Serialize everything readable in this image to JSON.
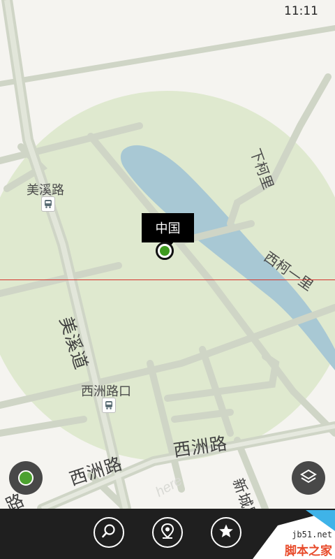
{
  "status_bar": {
    "time": "11:11"
  },
  "map": {
    "place_labels": {
      "meixi_road": "美溪路",
      "xiazhou_road_stop": "西洲路口",
      "xiake_li": "下柯里",
      "xike_yi_li": "西柯一里"
    },
    "road_labels": {
      "meixi_dao": "美溪道",
      "xizhou_road_main": "西洲路",
      "xizhou_road_lower": "西洲路",
      "xincheng_road": "新城路",
      "partial_road": "路"
    },
    "watermark_logo": "here",
    "colors": {
      "accuracy_circle": "#dfe9cf",
      "water": "#a8c8d4",
      "road": "#cfd5c6",
      "pin": "#3e9a1f"
    }
  },
  "location_callout": {
    "label": "中国"
  },
  "controls": {
    "locate_icon": "location-dot-icon",
    "layers_icon": "layers-icon"
  },
  "app_bar": {
    "buttons": [
      {
        "icon": "search-icon"
      },
      {
        "icon": "location-pin-icon"
      },
      {
        "icon": "star-icon"
      }
    ]
  },
  "site_watermark": {
    "url": "jb51.net",
    "name": "脚本之家"
  }
}
